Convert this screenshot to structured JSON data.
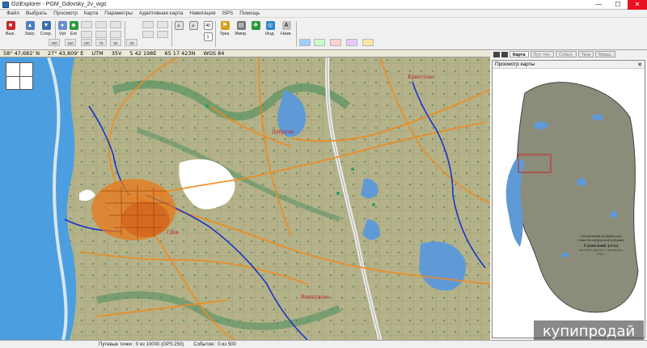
{
  "window": {
    "title": "OziExplorer - PGM_Gdovsky_2v_wgs",
    "minimize": "—",
    "maximize": "☐",
    "close": "✕"
  },
  "menu": [
    "Файл",
    "Выбрать",
    "Просмотр",
    "Карта",
    "Параметры",
    "Адаптивная карта",
    "Навигация",
    "GPS",
    "Помощь"
  ],
  "toolbar": {
    "exit": "Вых.",
    "load": "Загр.",
    "save": "Сохр.",
    "vpt": "Vpt",
    "ext": "Ext",
    "track": "Трек.",
    "print": "Импр.",
    "nav": "Инд.",
    "name": "Назв.",
    "zoom_small": [
      "200",
      "150",
      "100",
      "75",
      "50",
      "25"
    ],
    "num_badges": [
      "40",
      "1"
    ]
  },
  "coords": {
    "lat": "58° 47,682' N",
    "lon": "27° 43,809' E",
    "utm": "UTM",
    "zone": "35V",
    "easting": "5 42 198E",
    "northing": "65 17 423N",
    "datum": "WGS 84"
  },
  "panel_tabs": {
    "map": "Карта",
    "waypoints": "Пут. точ.",
    "events": "Событ.",
    "tracks": "Трек",
    "routes": "Марш."
  },
  "overview": {
    "title": "Просмотр карты",
    "close": "✕",
    "legend_lines": [
      "Генеральный уездный план",
      "Санкт-Петербургской губернии",
      "Гдовский уезд",
      "масштаб 1 верста в 1 английском",
      "1790 г."
    ]
  },
  "map_labels": [
    "Гдов",
    "Добручи",
    "Кунестово",
    "Вепшуково"
  ],
  "status": {
    "waypoints": "Путевые точки : 0 из 10000  (GPS:250)",
    "events": "События : 0 из 500"
  },
  "watermark": "купипродай",
  "colors": {
    "road": "#f08a1e",
    "river": "#1a34c8",
    "lake": "#5f9ad6",
    "forest": "#3f8a5a",
    "town": "#e9781a",
    "accent": "#2e6db4"
  }
}
